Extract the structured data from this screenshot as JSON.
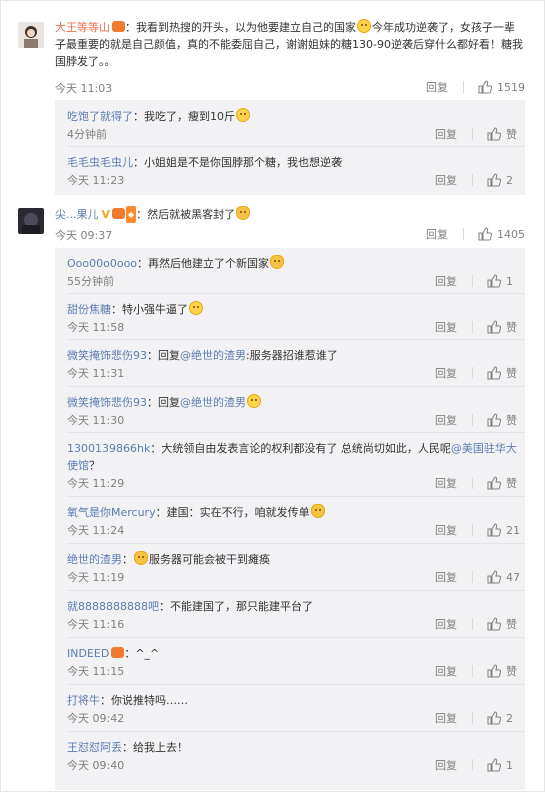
{
  "labels": {
    "reply": "回复",
    "zan": "赞"
  },
  "c1": {
    "name": "大王等等山",
    "text": "：我看到热搜的开头，以为他要建立自己的国家",
    "text2": "今年成功逆袭了，女孩子一辈子最重要的就是自己颜值，真的不能委屈自己，谢谢姐妹的糖130-90逆袭后穿什么都好看！糖我国脖发了。。",
    "time": "今天 11:03",
    "likes": "1519"
  },
  "c1_replies": [
    {
      "name": "吃饱了就得了",
      "text": "：我吃了，瘦到10斤",
      "time": "4分钟前",
      "likes": "赞"
    },
    {
      "name": "毛毛虫毛虫儿",
      "text": "：小姐姐是不是你国脖那个糖，我也想逆袭",
      "time": "今天 11:23",
      "likes": "2"
    }
  ],
  "c2": {
    "name": "尖...果儿",
    "text": "：然后就被黑客封了",
    "time": "今天 09:37",
    "likes": "1405"
  },
  "c2_replies": [
    {
      "name": "Ooo00o0ooo",
      "text": "：再然后他建立了个新国家",
      "time": "55分钟前",
      "likes": "1"
    },
    {
      "name": "甜份焦糖",
      "text": "：特小强牛逼了",
      "time": "今天 11:58",
      "likes": "赞"
    },
    {
      "name": "微笑掩饰悲伤93",
      "text": "：回复",
      "at": "@绝世的渣男",
      "text2": ":服务器招谁惹谁了",
      "time": "今天 11:31",
      "likes": "赞"
    },
    {
      "name": "微笑掩饰悲伤93",
      "text": "：回复",
      "at": "@绝世的渣男",
      "text2": "",
      "time": "今天 11:30",
      "likes": "赞"
    },
    {
      "name": "1300139866hk",
      "text": "：大统领自由发表言论的权利都没有了 总统尚切如此，人民呢",
      "at": "@美国驻华大使馆",
      "text2": "？",
      "time": "今天 11:29",
      "likes": "赞"
    },
    {
      "name": "氧气是你Mercury",
      "text": "：建国：实在不行，咱就发传单",
      "time": "今天 11:24",
      "likes": "21"
    },
    {
      "name": "绝世的渣男",
      "text": "：",
      "text2": "服务器可能会被干到瘫痪",
      "time": "今天 11:19",
      "likes": "47"
    },
    {
      "name": "就8888888888吧",
      "text": "：不能建国了，那只能建平台了",
      "time": "今天 11:16",
      "likes": "赞"
    },
    {
      "name": "INDEED",
      "text": "：^_^",
      "time": "今天 11:15",
      "likes": "赞"
    },
    {
      "name": "打将牛",
      "text": "：你说推特吗……",
      "time": "今天 09:42",
      "likes": "2"
    },
    {
      "name": "王怼怼阿丢",
      "text": "：给我上去！",
      "time": "今天 09:40",
      "likes": "1"
    }
  ]
}
